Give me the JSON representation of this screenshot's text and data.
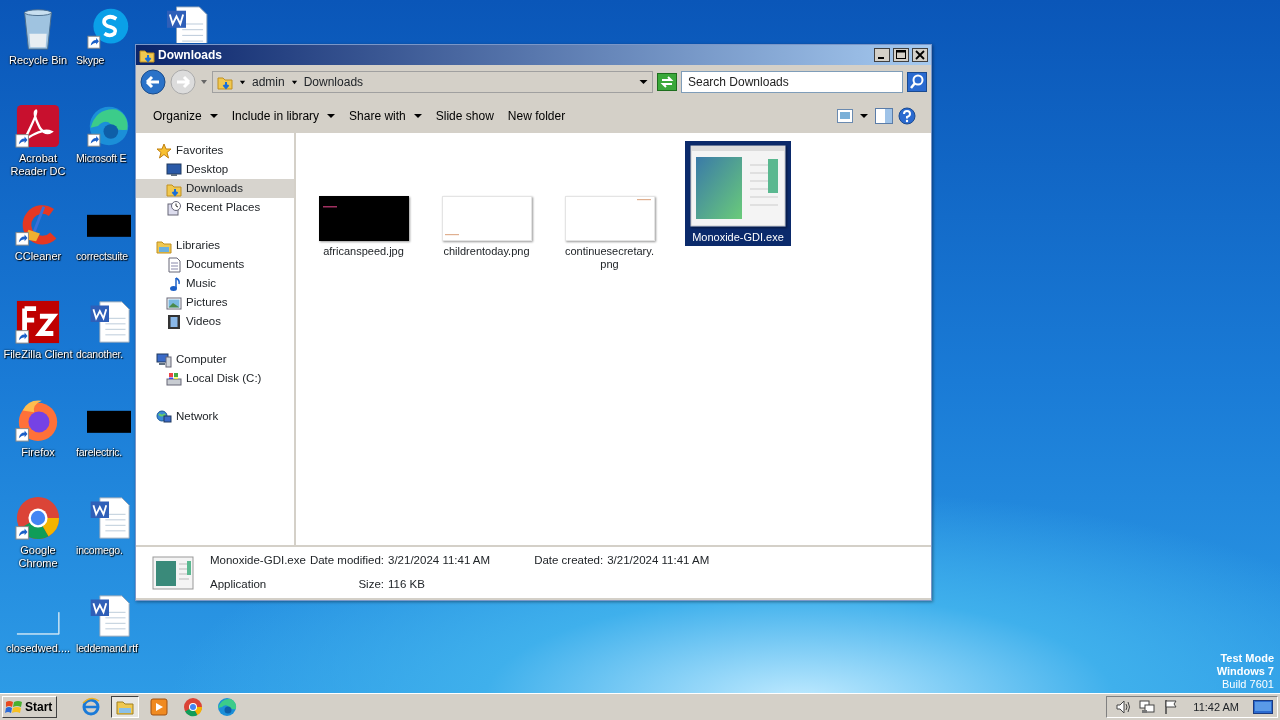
{
  "desktop_icons": [
    {
      "label": "Recycle Bin",
      "kind": "recycle",
      "shortcut": false
    },
    {
      "label": "Skype",
      "kind": "skype",
      "shortcut": true
    },
    {
      "label": "Acrobat Reader DC",
      "kind": "acrobat",
      "shortcut": true
    },
    {
      "label": "Microsoft E",
      "kind": "edge",
      "shortcut": true
    },
    {
      "label": "CCleaner",
      "kind": "ccleaner",
      "shortcut": true
    },
    {
      "label": "correctsuite",
      "kind": "black",
      "shortcut": false
    },
    {
      "label": "FileZilla Client",
      "kind": "filezilla",
      "shortcut": true
    },
    {
      "label": "dcanother.",
      "kind": "word",
      "shortcut": false
    },
    {
      "label": "Firefox",
      "kind": "firefox",
      "shortcut": true
    },
    {
      "label": "farelectric.",
      "kind": "black",
      "shortcut": false
    },
    {
      "label": "Google Chrome",
      "kind": "chrome",
      "shortcut": true
    },
    {
      "label": "incomego.",
      "kind": "word",
      "shortcut": false
    },
    {
      "label": "closedwed....",
      "kind": "blank",
      "shortcut": false
    },
    {
      "label": "leddemand.rtf",
      "kind": "word",
      "shortcut": false
    }
  ],
  "desktop_partial_icons": [
    {
      "kind": "word"
    }
  ],
  "window": {
    "title": "Downloads",
    "breadcrumb": [
      "admin",
      "Downloads"
    ],
    "search": {
      "placeholder": "Search Downloads"
    },
    "toolbar": [
      {
        "label": "Organize",
        "dropdown": true
      },
      {
        "label": "Include in library",
        "dropdown": true
      },
      {
        "label": "Share with",
        "dropdown": true
      },
      {
        "label": "Slide show",
        "dropdown": false
      },
      {
        "label": "New folder",
        "dropdown": false
      }
    ],
    "nav": [
      {
        "label": "Favorites",
        "kind": "star",
        "selected": false,
        "children": [
          {
            "label": "Desktop",
            "kind": "desktop",
            "selected": false
          },
          {
            "label": "Downloads",
            "kind": "downloads",
            "selected": true
          },
          {
            "label": "Recent Places",
            "kind": "recent",
            "selected": false
          }
        ]
      },
      {
        "label": "Libraries",
        "kind": "library",
        "selected": false,
        "children": [
          {
            "label": "Documents",
            "kind": "document",
            "selected": false
          },
          {
            "label": "Music",
            "kind": "music",
            "selected": false
          },
          {
            "label": "Pictures",
            "kind": "pictures",
            "selected": false
          },
          {
            "label": "Videos",
            "kind": "video",
            "selected": false
          }
        ]
      },
      {
        "label": "Computer",
        "kind": "computer",
        "selected": false,
        "children": [
          {
            "label": "Local Disk (C:)",
            "kind": "disk",
            "selected": false
          }
        ]
      },
      {
        "label": "Network",
        "kind": "network",
        "selected": false
      }
    ],
    "files": [
      {
        "name": "africanspeed.jpg",
        "kind": "black",
        "selected": false
      },
      {
        "name": "childrentoday.png",
        "kind": "white",
        "selected": false
      },
      {
        "name": "continuesecretary.png",
        "kind": "white",
        "selected": false
      },
      {
        "name": "Monoxide-GDI.exe",
        "kind": "app",
        "selected": true
      }
    ],
    "details": {
      "name": "Monoxide-GDI.exe",
      "type": "Application",
      "fields": [
        {
          "label": "Date modified:",
          "value": "3/21/2024 11:41 AM"
        },
        {
          "label": "Size:",
          "value": "116 KB"
        },
        {
          "label": "Date created:",
          "value": "3/21/2024 11:41 AM"
        }
      ]
    }
  },
  "desktop_notice": [
    "Test Mode",
    "Windows 7",
    "Build 7601"
  ],
  "taskbar": {
    "start": "Start",
    "apps": [
      {
        "kind": "ie",
        "active": false
      },
      {
        "kind": "explorer",
        "active": true
      },
      {
        "kind": "media",
        "active": false
      },
      {
        "kind": "chrome",
        "active": false
      },
      {
        "kind": "edge",
        "active": false
      }
    ],
    "clock": "11:42 AM"
  }
}
